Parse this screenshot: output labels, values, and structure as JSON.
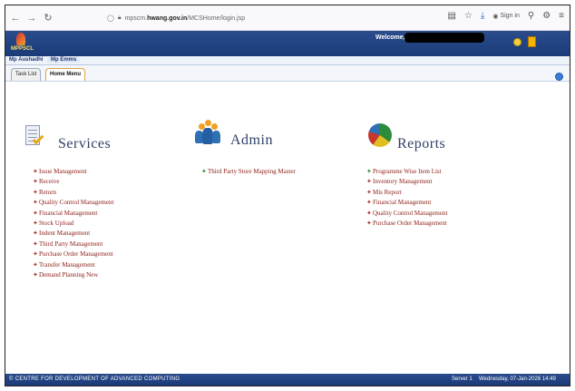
{
  "browser": {
    "url_prefix": "mpscm.",
    "url_host": "hwang.gov.in",
    "url_path": "/MCSHome/login.jsp",
    "sign_in": "Sign in"
  },
  "header": {
    "logo_text": "MPPSCL",
    "welcome": "Welcome,"
  },
  "modules": [
    "Mp Aushadhi",
    "Mp Emms"
  ],
  "tabs": [
    "Task List",
    "Home Menu"
  ],
  "sections": {
    "services": {
      "title": "Services",
      "items": [
        "Issue Management",
        "Receive",
        "Return",
        "Quality Control Management",
        "Financial Management",
        "Stock Upload",
        "Indent Management",
        "Third Party Management",
        "Purchase Order Management",
        "Transfer Management",
        "Demand Planning New"
      ]
    },
    "admin": {
      "title": "Admin",
      "items": [
        "Third Party Store Mapping Master"
      ]
    },
    "reports": {
      "title": "Reports",
      "items": [
        "Programme Wise Item List",
        "Inventory Management",
        "Mis Report",
        "Financial Management",
        "Quality Control Management",
        "Purchase Order Management"
      ]
    }
  },
  "footer": {
    "org": "© CENTRE FOR DEVELOPMENT OF ADVANCED COMPUTING",
    "server": "Server 1",
    "datetime": "Wednesday, 07-Jan-2026 14:49"
  },
  "colors": {
    "header_blue": "#1a3a78",
    "link_red": "#8a1d16",
    "title_navy": "#2f3f66",
    "active_tab_border": "#d9a640"
  }
}
